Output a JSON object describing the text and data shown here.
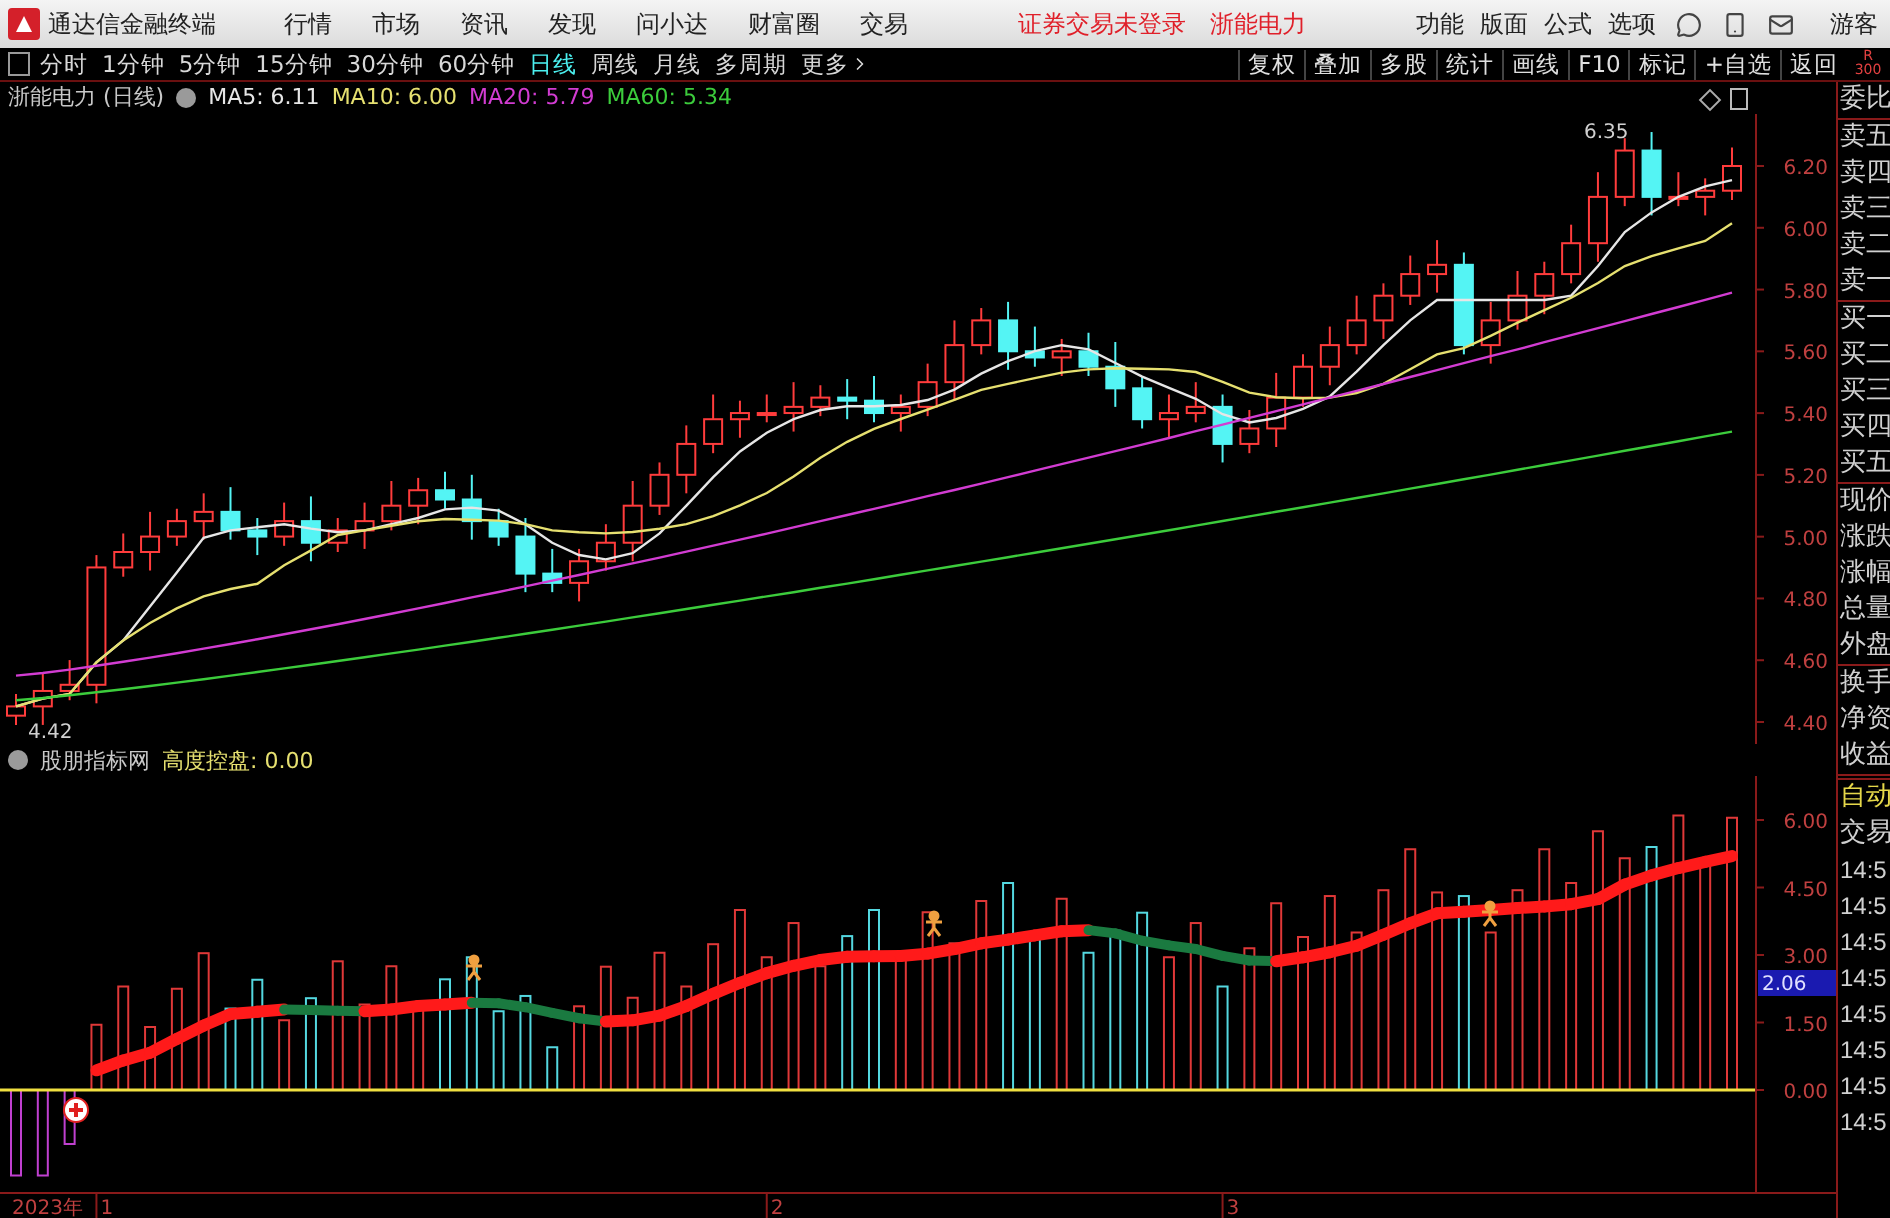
{
  "app": {
    "title": "通达信金融终端"
  },
  "menu": [
    "行情",
    "市场",
    "资讯",
    "发现",
    "问小达",
    "财富圈",
    "交易"
  ],
  "notices": [
    "证券交易未登录",
    "浙能电力"
  ],
  "right_menu": [
    "功能",
    "版面",
    "公式",
    "选项"
  ],
  "user": "游客",
  "periods": [
    {
      "label": "分时",
      "selected": false
    },
    {
      "label": "1分钟",
      "selected": false
    },
    {
      "label": "5分钟",
      "selected": false
    },
    {
      "label": "15分钟",
      "selected": false
    },
    {
      "label": "30分钟",
      "selected": false
    },
    {
      "label": "60分钟",
      "selected": false
    },
    {
      "label": "日线",
      "selected": true
    },
    {
      "label": "周线",
      "selected": false
    },
    {
      "label": "月线",
      "selected": false
    },
    {
      "label": "多周期",
      "selected": false
    }
  ],
  "more": "更多",
  "tools": [
    "复权",
    "叠加",
    "多股",
    "统计",
    "画线",
    "F10",
    "标记",
    "+自选",
    "返回"
  ],
  "corner": [
    "R",
    "300"
  ],
  "price_chart": {
    "title": "浙能电力 (日线)",
    "legend": [
      {
        "label": "MA5: 6.11",
        "color": "#e6e6e6"
      },
      {
        "label": "MA10: 6.00",
        "color": "#e6e070"
      },
      {
        "label": "MA20: 5.79",
        "color": "#d23cd2"
      },
      {
        "label": "MA60: 5.34",
        "color": "#3ccc3c"
      }
    ],
    "high_label": "6.35",
    "low_label": "4.42",
    "yticks": [
      "6.20",
      "6.00",
      "5.80",
      "5.60",
      "5.40",
      "5.20",
      "5.00",
      "4.80",
      "4.60",
      "4.40"
    ]
  },
  "indicator": {
    "name": "股朋指标网",
    "legend": "高度控盘: 0.00",
    "yticks": [
      "6.00",
      "4.50",
      "3.00",
      "1.50",
      "0.00"
    ],
    "value_tag": "2.06"
  },
  "time_axis": [
    "2023年",
    "1",
    "2",
    "3"
  ],
  "side_panel": {
    "groups": [
      [
        "委比"
      ],
      [
        "卖五",
        "卖四",
        "卖三",
        "卖二",
        "卖一"
      ],
      [
        "买一",
        "买二",
        "买三",
        "买四",
        "买五"
      ],
      [
        "现价",
        "涨跌",
        "涨幅",
        "总量",
        "外盘"
      ],
      [
        "换手",
        "净资",
        "收益"
      ]
    ],
    "mode": "自动",
    "trade": "交易",
    "times": [
      "14:5",
      "14:5",
      "14:5",
      "14:5",
      "14:5",
      "14:5",
      "14:5",
      "14:5"
    ]
  }
}
